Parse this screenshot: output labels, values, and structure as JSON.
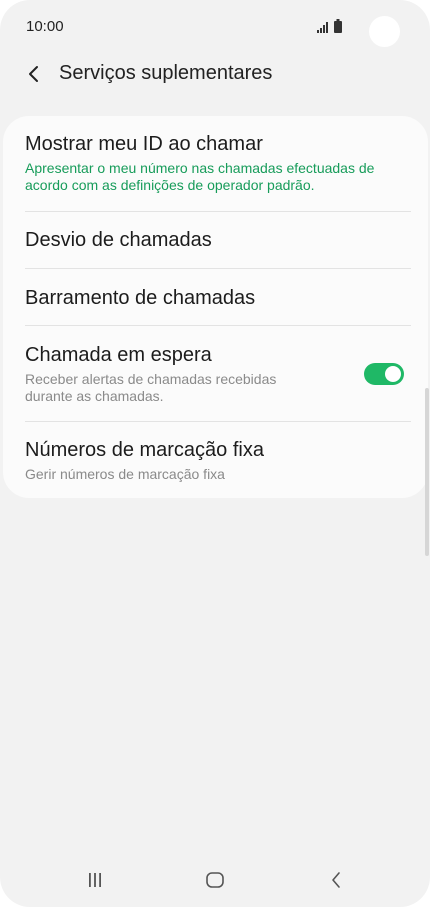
{
  "status_bar": {
    "time": "10:00",
    "icons": [
      "signal-icon",
      "battery-icon"
    ]
  },
  "header": {
    "back_icon": "chevron-left-icon",
    "title": "Serviços suplementares"
  },
  "settings": {
    "items": [
      {
        "title": "Mostrar meu ID ao chamar",
        "subtitle": "Apresentar o meu número nas chamadas efectuadas de acordo com as definições de operador padrão."
      },
      {
        "title": "Desvio de chamadas"
      },
      {
        "title": "Barramento de chamadas"
      },
      {
        "title": "Chamada em espera",
        "subtitle": "Receber alertas de chamadas recebidas durante as chamadas.",
        "toggle": "on"
      },
      {
        "title": "Números de marcação fixa",
        "subtitle": "Gerir números de marcação fixa"
      }
    ]
  },
  "colors": {
    "accent": "#1fb866",
    "subtitle_green": "#179c5a",
    "background": "#f2f2f2",
    "card": "#fbfbfb"
  },
  "nav_bar": {
    "icons": [
      "recent-apps-icon",
      "home-icon",
      "back-icon"
    ]
  }
}
